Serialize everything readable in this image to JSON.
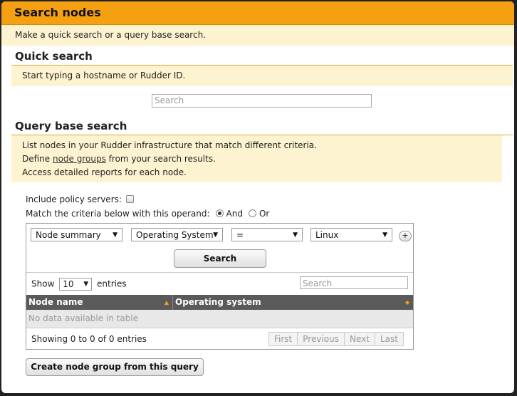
{
  "header": {
    "title": "Search nodes"
  },
  "intro": {
    "text": "Make a quick search or a query base search."
  },
  "quick": {
    "title": "Quick search",
    "hint": "Start typing a hostname or Rudder ID.",
    "placeholder": "Search"
  },
  "query": {
    "title": "Query base search",
    "line1": "List nodes in your Rudder infrastructure that match different criteria.",
    "line2_pre": "Define ",
    "line2_link": "node groups",
    "line2_post": " from your search results.",
    "line3": "Access detailed reports for each node."
  },
  "options": {
    "include_label": "Include policy servers:",
    "match_label": "Match the criteria below with this operand:",
    "and_label": "And",
    "or_label": "Or",
    "operand": "And"
  },
  "criteria": {
    "object": "Node summary",
    "attribute": "Operating System",
    "comparator": "=",
    "value": "Linux",
    "add": "+"
  },
  "search_button": "Search",
  "table": {
    "show_label": "Show",
    "page_length": "10",
    "entries_label": "entries",
    "search_placeholder": "Search",
    "columns": [
      "Node name",
      "Operating system"
    ],
    "empty": "No data available in table",
    "info": "Showing 0 to 0 of 0 entries",
    "pager": [
      "First",
      "Previous",
      "Next",
      "Last"
    ]
  },
  "create_group_button": "Create node group from this query"
}
